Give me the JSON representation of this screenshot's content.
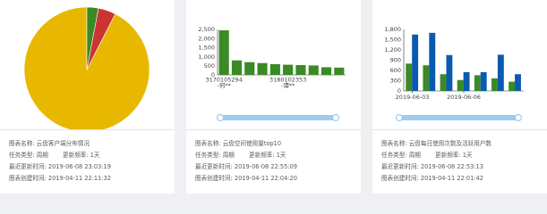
{
  "cards": [
    {
      "chart_name_label": "图表名称:",
      "chart_name": "云盘客户端分布情况",
      "task_type_label": "任务类型:",
      "task_type": "周期",
      "frequency_label": "更新频率:",
      "frequency": "1天",
      "last_update_label": "最近更新时间:",
      "last_update": "2019-06-08 23:03:19",
      "created_label": "图表创建时间:",
      "created": "2019-04-11 22:11:32"
    },
    {
      "chart_name_label": "图表名称:",
      "chart_name": "云盘空间使用量top10",
      "task_type_label": "任务类型:",
      "task_type": "周期",
      "frequency_label": "更新频率:",
      "frequency": "1天",
      "last_update_label": "最近更新时间:",
      "last_update": "2019-06-08 22:55:09",
      "created_label": "图表创建时间:",
      "created": "2019-04-11 22:04:20"
    },
    {
      "chart_name_label": "图表名称:",
      "chart_name": "云盘每日使用次数及活跃用户数",
      "task_type_label": "任务类型:",
      "task_type": "周期",
      "frequency_label": "更新频率:",
      "frequency": "1天",
      "last_update_label": "最近更新时间:",
      "last_update": "2019-06-08 22:53:13",
      "created_label": "图表创建时间:",
      "created": "2019-04-11 22:01:42"
    }
  ],
  "colors": {
    "pie_yellow": "#e8b800",
    "pie_green": "#3a8a26",
    "pie_red": "#cc3333",
    "bar_green": "#3a8a26",
    "bar_blue": "#0a5ab0",
    "slider": "#9ecbf0"
  },
  "chart_data": [
    {
      "type": "pie",
      "slices": [
        {
          "value": 92.5,
          "color": "#e8b800"
        },
        {
          "value": 3.0,
          "color": "#3a8a26"
        },
        {
          "value": 4.5,
          "color": "#cc3333"
        }
      ]
    },
    {
      "type": "bar",
      "tick_labels_x": [
        {
          "index": 0,
          "line1": "3170105294",
          "line2": "-何**"
        },
        {
          "index": 5,
          "line1": "3180102353",
          "line2": "-谭**"
        }
      ],
      "values": [
        2450,
        800,
        700,
        650,
        590,
        560,
        540,
        520,
        420,
        400
      ],
      "ylim": [
        0,
        2500
      ],
      "yticks": [
        "0",
        "500",
        "1,000",
        "1,500",
        "2,000",
        "2,500"
      ],
      "ytick_values": [
        0,
        500,
        1000,
        1500,
        2000,
        2500
      ]
    },
    {
      "type": "bar",
      "tick_labels_x": [
        {
          "index": 0,
          "label": "2019-06-03"
        },
        {
          "index": 3,
          "label": "2019-06-06"
        }
      ],
      "series": [
        {
          "values": [
            800,
            750,
            490,
            320,
            460,
            370,
            270
          ]
        },
        {
          "values": [
            1650,
            1700,
            1050,
            550,
            550,
            1060,
            490
          ]
        }
      ],
      "ylim": [
        0,
        1800
      ],
      "yticks": [
        "0",
        "300",
        "600",
        "900",
        "1,200",
        "1,500",
        "1,800"
      ],
      "ytick_values": [
        0,
        300,
        600,
        900,
        1200,
        1500,
        1800
      ]
    }
  ]
}
